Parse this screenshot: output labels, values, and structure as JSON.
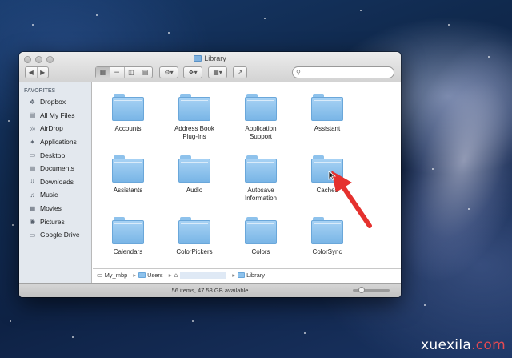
{
  "window": {
    "title": "Library"
  },
  "toolbar": {
    "search_placeholder": ""
  },
  "sidebar": {
    "heading": "FAVORITES",
    "items": [
      {
        "label": "Dropbox",
        "icon": "dropbox-icon"
      },
      {
        "label": "All My Files",
        "icon": "all-files-icon"
      },
      {
        "label": "AirDrop",
        "icon": "airdrop-icon"
      },
      {
        "label": "Applications",
        "icon": "applications-icon"
      },
      {
        "label": "Desktop",
        "icon": "desktop-icon"
      },
      {
        "label": "Documents",
        "icon": "documents-icon"
      },
      {
        "label": "Downloads",
        "icon": "downloads-icon"
      },
      {
        "label": "Music",
        "icon": "music-icon"
      },
      {
        "label": "Movies",
        "icon": "movies-icon"
      },
      {
        "label": "Pictures",
        "icon": "pictures-icon"
      },
      {
        "label": "Google Drive",
        "icon": "folder-icon"
      }
    ]
  },
  "folders": [
    {
      "name": "Accounts"
    },
    {
      "name": "Address Book Plug-Ins"
    },
    {
      "name": "Application Support"
    },
    {
      "name": "Assistant"
    },
    {
      "name": "Assistants"
    },
    {
      "name": "Audio"
    },
    {
      "name": "Autosave Information"
    },
    {
      "name": "Caches"
    },
    {
      "name": "Calendars"
    },
    {
      "name": "ColorPickers"
    },
    {
      "name": "Colors"
    },
    {
      "name": "ColorSync"
    }
  ],
  "pathbar": {
    "items": [
      "My_mbp",
      "Users",
      "",
      "Library"
    ]
  },
  "status": {
    "text": "56 items, 47.58 GB available"
  },
  "watermark": {
    "name": "xuexila",
    "domain": ".com"
  },
  "colors": {
    "folder": "#8ec2ec",
    "arrow": "#e5312e"
  }
}
